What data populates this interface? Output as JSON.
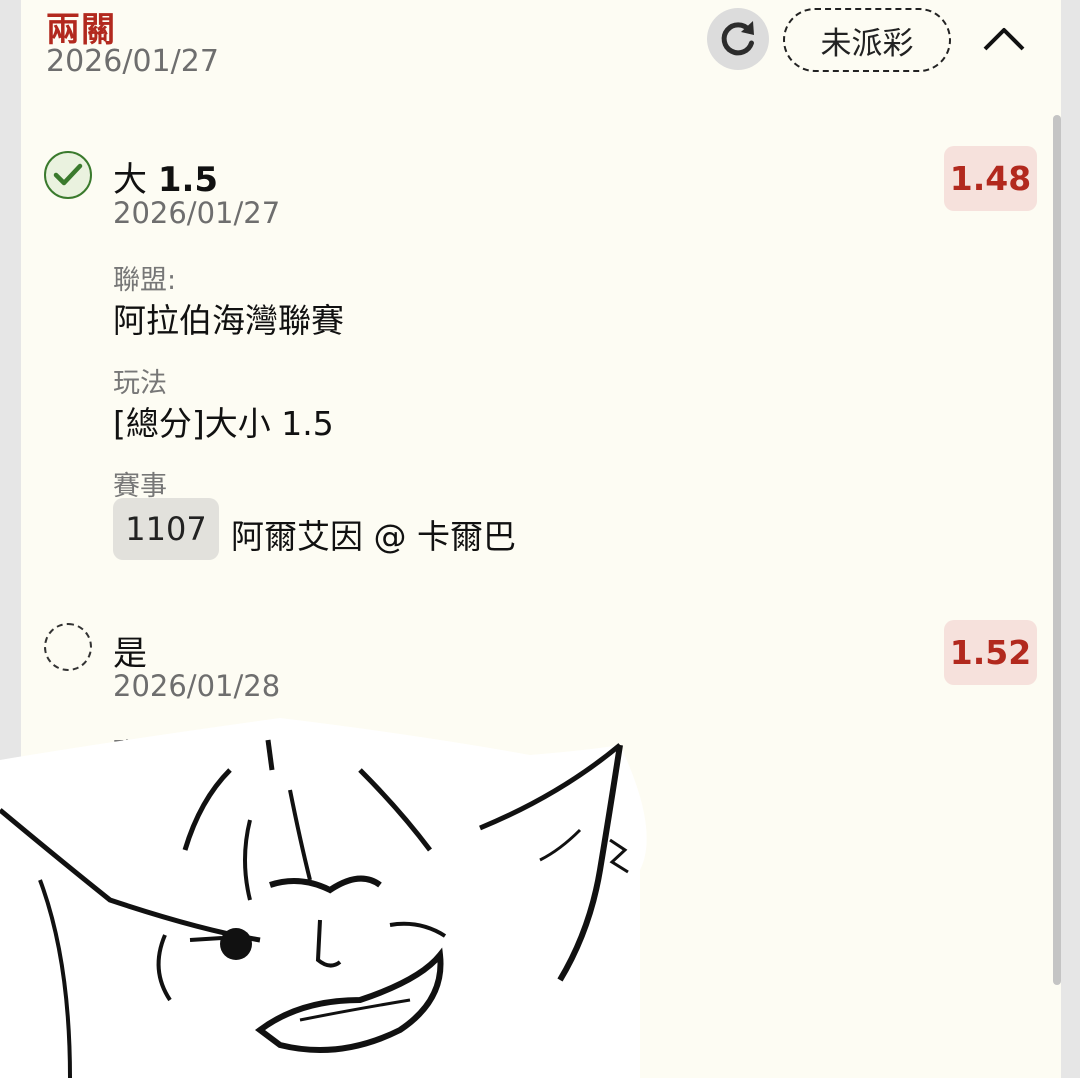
{
  "header": {
    "bet_type": "兩關",
    "date": "2026/01/27",
    "status": "未派彩"
  },
  "legs": [
    {
      "status": "won",
      "selection_prefix": "大",
      "selection_value": "1.5",
      "date": "2026/01/27",
      "odds": "1.48",
      "league_label": "聯盟:",
      "league": "阿拉伯海灣聯賽",
      "market_label": "玩法",
      "market": "[總分]大小 1.5",
      "match_label": "賽事",
      "match_code": "1107",
      "match": "阿爾艾因 @ 卡爾巴"
    },
    {
      "status": "pending",
      "selection_prefix": "是",
      "date": "2026/01/28",
      "odds": "1.52",
      "league_label": "聯盟:"
    }
  ],
  "colors": {
    "accent_red": "#b2291e",
    "won_green": "#3a7a2d",
    "card_bg": "#fdfcf3"
  },
  "icons": [
    "refresh-icon",
    "chevron-up-icon",
    "check-circle-icon",
    "pending-circle-icon"
  ]
}
